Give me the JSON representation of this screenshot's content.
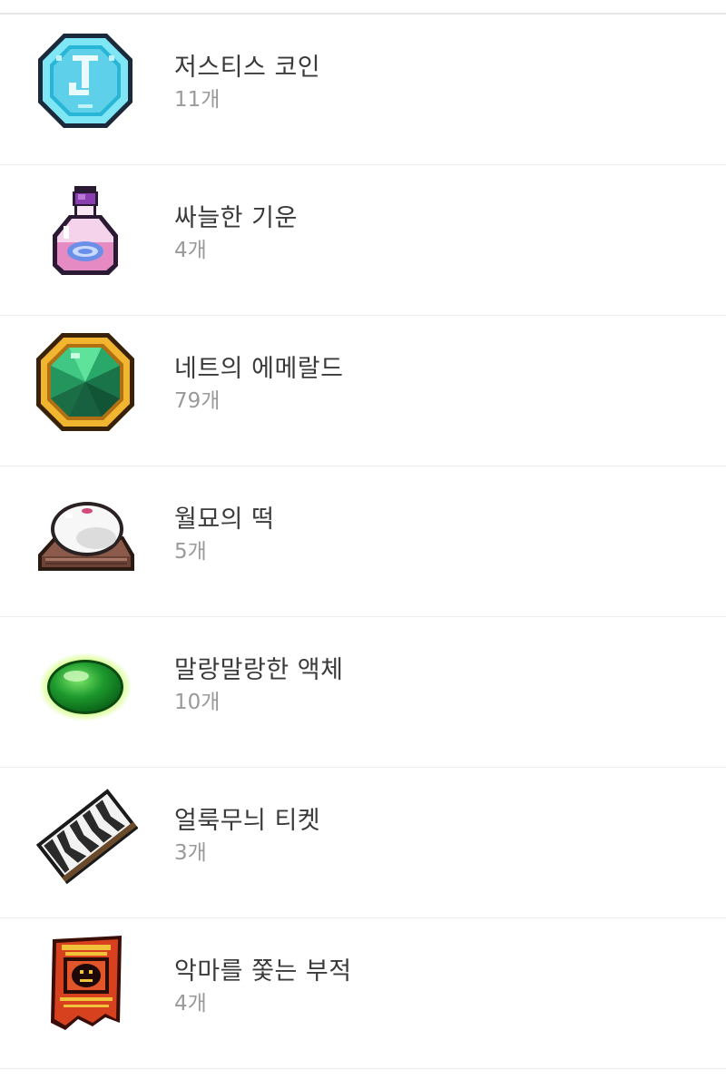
{
  "items": [
    {
      "name": "저스티스 코인",
      "count": "11개",
      "icon": "justice-coin-icon"
    },
    {
      "name": "싸늘한 기운",
      "count": "4개",
      "icon": "potion-bottle-icon"
    },
    {
      "name": "네트의 에메랄드",
      "count": "79개",
      "icon": "emerald-gem-icon"
    },
    {
      "name": "월묘의 떡",
      "count": "5개",
      "icon": "rice-cake-icon"
    },
    {
      "name": "말랑말랑한 액체",
      "count": "10개",
      "icon": "green-slime-icon"
    },
    {
      "name": "얼룩무늬 티켓",
      "count": "3개",
      "icon": "zebra-ticket-icon"
    },
    {
      "name": "악마를 쫓는 부적",
      "count": "4개",
      "icon": "talisman-icon"
    }
  ]
}
